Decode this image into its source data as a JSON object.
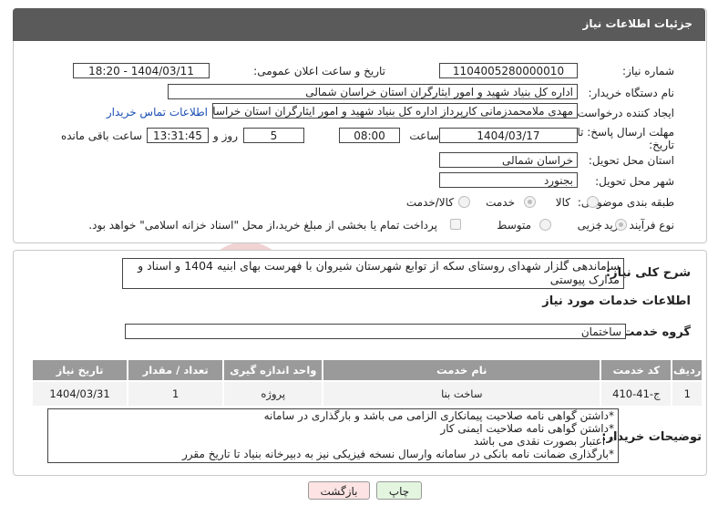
{
  "header": {
    "title": "جزئیات اطلاعات نیاز"
  },
  "form": {
    "need_number_label": "شماره نیاز:",
    "need_number": "1104005280000010",
    "announce_label": "تاریخ و ساعت اعلان عمومی:",
    "announce_value": "1404/03/11 - 18:20",
    "buyer_org_label": "نام دستگاه خریدار:",
    "buyer_org": "اداره کل بنیاد شهید و امور ایثارگران استان خراسان شمالی",
    "creator_label": "ایجاد کننده درخواست:",
    "creator": "مهدی  ملامحمدزمانی کارپرداز اداره کل بنیاد شهید و امور ایثارگران استان خراسان شمالی",
    "contact_link": "اطلاعات تماس خریدار",
    "deadline_label_1": "مهلت ارسال پاسخ: تا",
    "deadline_label_2": "تاریخ:",
    "deadline_date": "1404/03/17",
    "time_label": "ساعت",
    "deadline_time": "08:00",
    "days_value": "5",
    "days_label": "روز و",
    "remaining_time": "13:31:45",
    "remaining_label": "ساعت باقی مانده",
    "province_label": "استان محل تحویل:",
    "province": "خراسان شمالی",
    "city_label": "شهر محل تحویل:",
    "city": "بجنورد",
    "category_label": "طبقه بندی موضوعی:",
    "category_options": [
      "کالا",
      "خدمت",
      "کالا/خدمت"
    ],
    "category_selected": "خدمت",
    "process_label": "نوع فرآیند خرید :",
    "process_options": [
      "جزیی",
      "متوسط"
    ],
    "process_selected": "جزیی",
    "payment_note": "پرداخت تمام یا بخشی از مبلغ خرید،از محل \"اسناد خزانه اسلامی\" خواهد بود."
  },
  "summary": {
    "label": "شرح کلی نیاز:",
    "text": "ساماندهی گلزار شهدای روستای سکه از توابع شهرستان شیروان با فهرست بهای ابنیه 1404 و اسناد و مدارک پیوستی"
  },
  "services": {
    "section_title": "اطلاعات خدمات مورد نیاز",
    "group_label": "گروه خدمت:",
    "group_value": "ساختمان",
    "columns": [
      "ردیف",
      "کد خدمت",
      "نام خدمت",
      "واحد اندازه گیری",
      "تعداد / مقدار",
      "تاریخ نیاز"
    ],
    "rows": [
      {
        "row": "1",
        "code": "ج-41-410",
        "name": "ساخت بنا",
        "unit": "پروژه",
        "qty": "1",
        "date": "1404/03/31"
      }
    ]
  },
  "notes": {
    "label": "توضیحات خریدار:",
    "lines": [
      "*داشتن گواهی نامه صلاحیت پیمانکاری الزامی می باشد و بارگذاری در سامانه",
      "*داشتن گواهی نامه صلاحیت ایمنی کار",
      "* اعتبار بصورت نقدی می باشد",
      "*بارگذاری ضمانت نامه بانکی در سامانه وارسال نسخه فیزیکی نیز به دبیرخانه بنیاد تا تاریخ مقرر"
    ]
  },
  "buttons": {
    "print": "چاپ",
    "back": "بازگشت"
  },
  "watermark": {
    "text": "AriaTender.net"
  },
  "colors": {
    "header_bg": "#5a5a5a",
    "table_head_bg": "#9a9a9a",
    "link": "#1a4fb3",
    "back_btn_bg": "#fde3e3",
    "print_btn_bg": "#e3f5df",
    "watermark": "#f1d3d3"
  }
}
